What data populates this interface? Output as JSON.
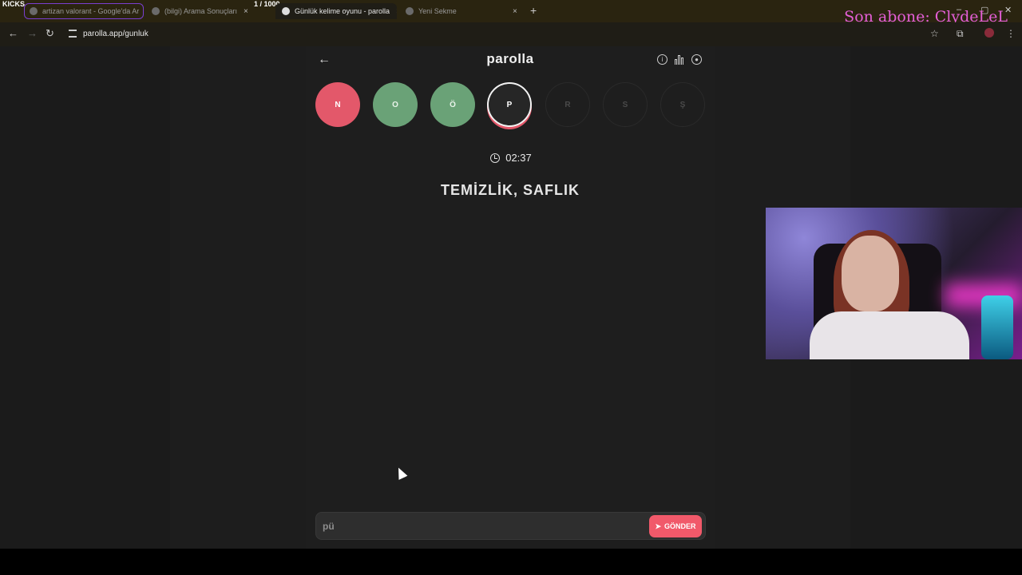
{
  "overlay": {
    "kicks_label": "KICKS",
    "counter": "1 / 1000",
    "subscriber_text": "Son abone: ClydeLeL"
  },
  "browser": {
    "tabs": [
      {
        "title": "artizan valorant - Google'da Ar"
      },
      {
        "title": "(bilgi) Arama Sonuçları"
      },
      {
        "title": "Günlük kelime oyunu - parolla"
      },
      {
        "title": "Yeni Sekme"
      }
    ],
    "new_tab": "+",
    "url": "parolla.app/gunluk",
    "close_glyph": "×"
  },
  "header": {
    "title": "parolla",
    "back_glyph": "←",
    "info_glyph": "i"
  },
  "letters": [
    {
      "char": "N",
      "state": "wrong"
    },
    {
      "char": "O",
      "state": "right"
    },
    {
      "char": "Ö",
      "state": "right"
    },
    {
      "char": "P",
      "state": "current"
    },
    {
      "char": "R",
      "state": "pending"
    },
    {
      "char": "S",
      "state": "pending"
    },
    {
      "char": "Ş",
      "state": "pending"
    }
  ],
  "timer": "02:37",
  "clue": "TEMİZLİK, SAFLIK",
  "answer": {
    "value": "pü",
    "send_label": "GÖNDER"
  },
  "colors": {
    "wrong": "#e3586a",
    "right": "#6aa277",
    "accent": "#f1596a",
    "overlay_text": "#e55fd7"
  }
}
